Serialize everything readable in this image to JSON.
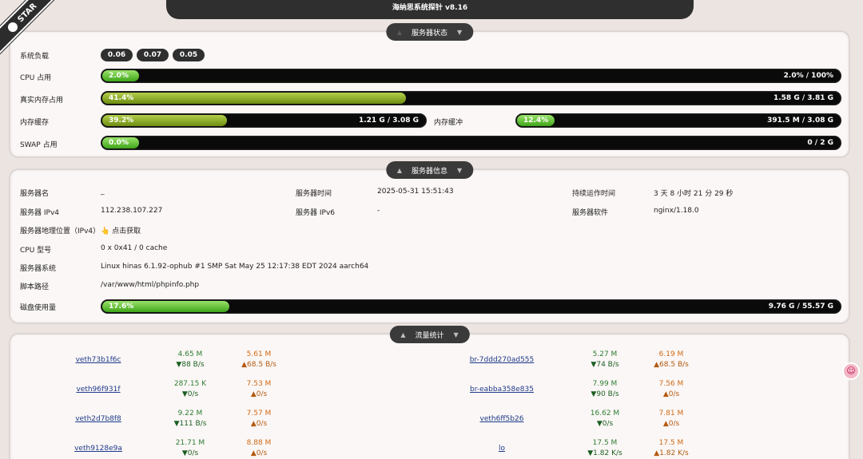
{
  "ribbon": {
    "label": "STAR"
  },
  "header": {
    "title": "海纳思系统探针 v8.16"
  },
  "status": {
    "heading": "服务器状态",
    "load_label": "系统负载",
    "load": [
      "0.06",
      "0.07",
      "0.05"
    ],
    "cpu": {
      "label": "CPU 占用",
      "pct": "2.0%",
      "value": "2.0% / 100%",
      "fraction": 0.02
    },
    "mem": {
      "label": "真实内存占用",
      "pct": "41.4%",
      "value": "1.58 G / 3.81 G",
      "fraction": 0.414
    },
    "cache": {
      "label": "内存缓存",
      "pct": "39.2%",
      "value": "1.21 G / 3.08 G",
      "fraction": 0.392
    },
    "buffer": {
      "label": "内存缓冲",
      "pct": "12.4%",
      "value": "391.5 M / 3.08 G",
      "fraction": 0.124
    },
    "swap": {
      "label": "SWAP 占用",
      "pct": "0.0%",
      "value": "0 / 2 G",
      "fraction": 0.0
    }
  },
  "info": {
    "heading": "服务器信息",
    "name_label": "服务器名",
    "name": "_",
    "time_label": "服务器时间",
    "time": "2025-05-31 15:51:43",
    "uptime_label": "持续运作时间",
    "uptime": "3 天 8 小时 21 分 29 秒",
    "ipv4_label": "服务器 IPv4",
    "ipv4": "112.238.107.227",
    "ipv6_label": "服务器 IPv6",
    "ipv6": "-",
    "software_label": "服务器软件",
    "software": "nginx/1.18.0",
    "geo_label": "服务器地理位置（IPv4）",
    "geo_action": "👆 点击获取",
    "cpu_label": "CPU 型号",
    "cpu_model": "0 x 0x41 / 0 cache",
    "os_label": "服务器系统",
    "os": "Linux hinas 6.1.92-ophub #1 SMP Sat May 25 12:17:38 EDT 2024 aarch64",
    "path_label": "脚本路径",
    "path": "/var/www/html/phpinfo.php",
    "disk_label": "磁盘使用量",
    "disk_pct": "17.6%",
    "disk_value": "9.76 G / 55.57 G",
    "disk_fraction": 0.176
  },
  "traffic": {
    "heading": "流量统计",
    "left": [
      {
        "name": "veth73b1f6c",
        "in_total": "4.65 M",
        "in_rate": "▼88 B/s",
        "out_total": "5.61 M",
        "out_rate": "▲68.5 B/s"
      },
      {
        "name": "veth96f931f",
        "in_total": "287.15 K",
        "in_rate": "▼0/s",
        "out_total": "7.53 M",
        "out_rate": "▲0/s"
      },
      {
        "name": "veth2d7b8f8",
        "in_total": "9.22 M",
        "in_rate": "▼111 B/s",
        "out_total": "7.57 M",
        "out_rate": "▲0/s"
      },
      {
        "name": "veth9128e9a",
        "in_total": "21.71 M",
        "in_rate": "▼0/s",
        "out_total": "8.88 M",
        "out_rate": "▲0/s"
      }
    ],
    "right": [
      {
        "name": "br-7ddd270ad555",
        "in_total": "5.27 M",
        "in_rate": "▼74 B/s",
        "out_total": "6.19 M",
        "out_rate": "▲68.5 B/s"
      },
      {
        "name": "br-eabba358e835",
        "in_total": "7.99 M",
        "in_rate": "▼90 B/s",
        "out_total": "7.56 M",
        "out_rate": "▲0/s"
      },
      {
        "name": "veth6ff5b26",
        "in_total": "16.62 M",
        "in_rate": "▼0/s",
        "out_total": "7.81 M",
        "out_rate": "▲0/s"
      },
      {
        "name": "lo",
        "in_total": "17.5 M",
        "in_rate": "▼1.82 K/s",
        "out_total": "17.5 M",
        "out_rate": "▲1.82 K/s"
      }
    ]
  }
}
